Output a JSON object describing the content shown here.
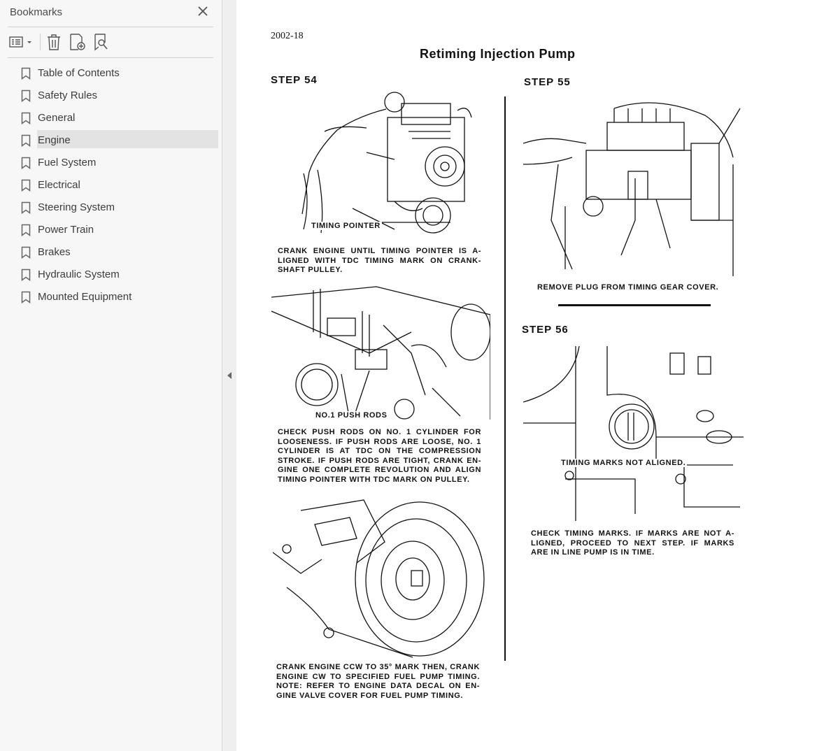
{
  "sidebar": {
    "title": "Bookmarks",
    "selected_index": 3,
    "items": [
      {
        "label": "Table of Contents"
      },
      {
        "label": "Safety Rules"
      },
      {
        "label": "General"
      },
      {
        "label": "Engine"
      },
      {
        "label": "Fuel System"
      },
      {
        "label": "Electrical"
      },
      {
        "label": "Steering System"
      },
      {
        "label": "Power Train"
      },
      {
        "label": "Brakes"
      },
      {
        "label": "Hydraulic System"
      },
      {
        "label": "Mounted Equipment"
      }
    ],
    "toolbar_icons": [
      "options-list-icon",
      "delete-icon",
      "new-bookmark-icon",
      "bookmark-search-icon"
    ]
  },
  "page": {
    "page_number": "2002-18",
    "title": "Retiming Injection Pump",
    "step54": {
      "heading": "STEP 54",
      "callout_1": "TIMING POINTER",
      "caption_1": "CRANK ENGINE UNTIL TIMING POINTER IS A-LIGNED WITH TDC TIMING MARK ON CRANK-SHAFT PULLEY.",
      "callout_2": "NO.1 PUSH RODS",
      "caption_2": "CHECK PUSH RODS ON NO. 1 CYLINDER FOR LOOSENESS. IF PUSH RODS ARE LOOSE, NO. 1 CYLINDER IS AT TDC ON THE COMPRESSION STROKE. IF PUSH RODS ARE TIGHT, CRANK EN-GINE ONE COMPLETE REVOLUTION AND ALIGN TIMING POINTER WITH TDC MARK ON PULLEY.",
      "caption_3": "CRANK ENGINE CCW TO 35° MARK THEN, CRANK ENGINE CW TO SPECIFIED FUEL PUMP TIMING. NOTE: REFER TO ENGINE DATA DECAL ON EN-GINE VALVE COVER FOR FUEL PUMP TIMING."
    },
    "step55": {
      "heading": "STEP 55",
      "caption": "REMOVE PLUG FROM TIMING GEAR COVER."
    },
    "step56": {
      "heading": "STEP 56",
      "callout": "TIMING MARKS NOT ALIGNED.",
      "caption": "CHECK TIMING MARKS. IF MARKS ARE NOT A-LIGNED, PROCEED TO NEXT STEP. IF MARKS ARE IN LINE PUMP IS IN TIME."
    }
  }
}
